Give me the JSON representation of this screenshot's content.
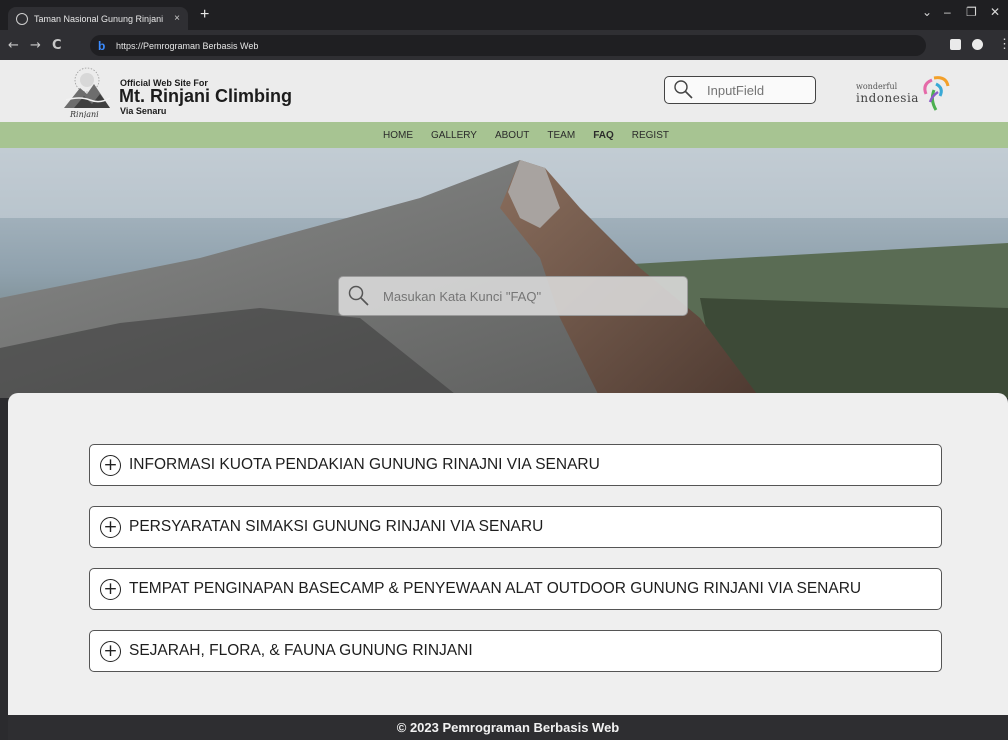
{
  "browser": {
    "tab_title": "Taman Nasional Gunung Rinjani",
    "tab_close": "×",
    "new_tab": "+",
    "url": "https://Pemrograman Berbasis Web",
    "window_controls": [
      "⌄",
      "–",
      "❐",
      "✕"
    ]
  },
  "header": {
    "brand_top": "Official Web Site For",
    "brand_main": "Mt. Rinjani Climbing",
    "brand_sub": "Via Senaru",
    "logo_caption": "Rinjani",
    "search_placeholder": "InputField",
    "partner_small": "wonderful",
    "partner_big": "indonesia"
  },
  "nav": {
    "items": [
      "HOME",
      "GALLERY",
      "ABOUT",
      "TEAM",
      "FAQ",
      "REGIST"
    ],
    "active": "FAQ"
  },
  "hero": {
    "search_placeholder": "Masukan Kata Kunci \"FAQ\""
  },
  "faq": {
    "items": [
      "INFORMASI KUOTA PENDAKIAN GUNUNG RINAJNI VIA SENARU",
      "PERSYARATAN SIMAKSI GUNUNG RINJANI VIA SENARU",
      "TEMPAT PENGINAPAN BASECAMP & PENYEWAAN ALAT OUTDOOR GUNUNG RINJANI VIA SENARU",
      "SEJARAH, FLORA, & FAUNA GUNUNG RINJANI"
    ]
  },
  "footer": {
    "text": "© 2023 Pemrograman Berbasis Web"
  },
  "colors": {
    "nav_green": "#a7c492",
    "footer_bg": "#2e2e31",
    "panel_bg": "#efefef"
  }
}
